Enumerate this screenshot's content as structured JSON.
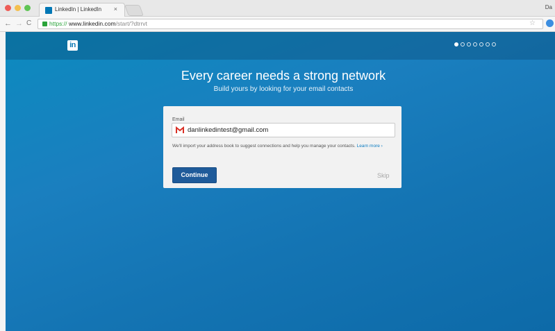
{
  "browser": {
    "tab_title": "LinkedIn | LinkedIn",
    "tab_close": "×",
    "profile_label": "Da",
    "url_secure": "https://",
    "url_host": "www.linkedin.com",
    "url_path": "/start/?dtrrvt"
  },
  "page": {
    "logo": "in",
    "progress": {
      "total_steps": 7,
      "current_step": 1
    },
    "headline": "Every career needs a strong network",
    "subheadline": "Build yours by looking for your email contacts",
    "form": {
      "email_label": "Email",
      "email_value": "danlinkedintest@gmail.com",
      "help_text": "We'll import your address book to suggest connections and help you manage your contacts.",
      "learn_more": "Learn more",
      "learn_more_suffix": " ›",
      "continue_label": "Continue",
      "skip_label": "Skip"
    }
  },
  "colors": {
    "linkedin_blue": "#0077b5",
    "button_blue": "#1f5b9a",
    "gmail_red": "#d93025"
  }
}
